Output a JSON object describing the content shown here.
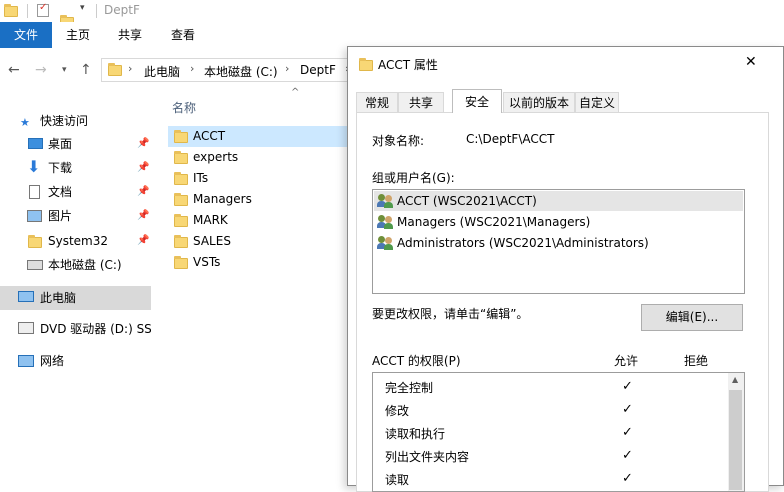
{
  "window": {
    "title": "DeptF"
  },
  "ribbon": {
    "tabs": [
      "文件",
      "主页",
      "共享",
      "查看"
    ]
  },
  "address": {
    "crumbs": [
      "此电脑",
      "本地磁盘 (C:)",
      "DeptF"
    ]
  },
  "nav": {
    "quick_access": "快速访问",
    "items": [
      "桌面",
      "下载",
      "文档",
      "图片",
      "System32",
      "本地磁盘 (C:)"
    ],
    "this_pc": "此电脑",
    "dvd": "DVD 驱动器 (D:) SSS",
    "network": "网络"
  },
  "filelist": {
    "column_header": "名称",
    "files": [
      "ACCT",
      "experts",
      "ITs",
      "Managers",
      "MARK",
      "SALES",
      "VSTs"
    ]
  },
  "dialog": {
    "title": "ACCT 属性",
    "close": "✕",
    "tabs": [
      "常规",
      "共享",
      "安全",
      "以前的版本",
      "自定义"
    ],
    "object_label": "对象名称:",
    "object_value": "C:\\DeptF\\ACCT",
    "group_label": "组或用户名(G):",
    "users": [
      "ACCT (WSC2021\\ACCT)",
      "Managers (WSC2021\\Managers)",
      "Administrators (WSC2021\\Administrators)"
    ],
    "change_hint": "要更改权限，请单击“编辑”。",
    "edit_button": "编辑(E)...",
    "perm_label": "ACCT 的权限(P)",
    "allow": "允许",
    "deny": "拒绝",
    "permissions": [
      {
        "name": "完全控制",
        "allow": true
      },
      {
        "name": "修改",
        "allow": true
      },
      {
        "name": "读取和执行",
        "allow": true
      },
      {
        "name": "列出文件夹内容",
        "allow": true
      },
      {
        "name": "读取",
        "allow": true
      }
    ],
    "check_glyph": "✓"
  }
}
